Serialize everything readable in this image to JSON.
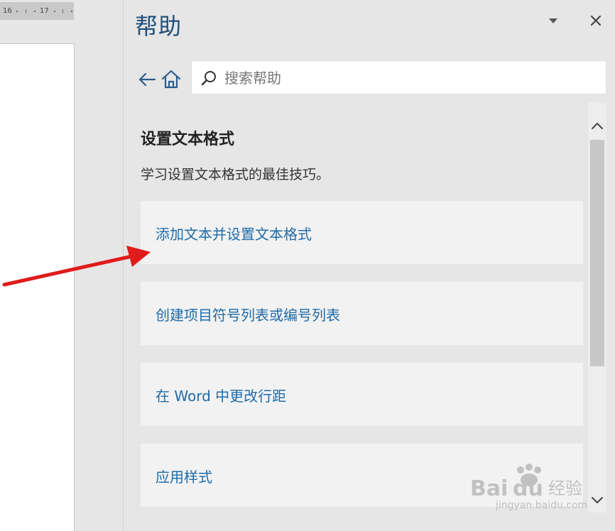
{
  "ruler": {
    "marks": [
      "16",
      "17"
    ]
  },
  "help_pane": {
    "title": "帮助",
    "menu_icon": "dropdown-triangle-icon",
    "close_icon": "close-icon",
    "nav": {
      "back_icon": "arrow-left-icon",
      "home_icon": "home-icon"
    },
    "search": {
      "placeholder": "搜索帮助",
      "value": "",
      "icon": "search-icon"
    }
  },
  "content": {
    "section_title": "设置文本格式",
    "section_desc": "学习设置文本格式的最佳技巧。",
    "topics": [
      {
        "label": "添加文本并设置文本格式"
      },
      {
        "label": "创建项目符号列表或编号列表"
      },
      {
        "label": "在 Word 中更改行距"
      },
      {
        "label": "应用样式"
      }
    ]
  },
  "colors": {
    "title": "#1e4e79",
    "link": "#1f6ba8",
    "pane_bg": "#e6e6e6",
    "card_bg": "#f2f2f2",
    "annotation_arrow": "#e01b1b"
  },
  "watermark": {
    "text": "jingyan.baidu.com"
  }
}
